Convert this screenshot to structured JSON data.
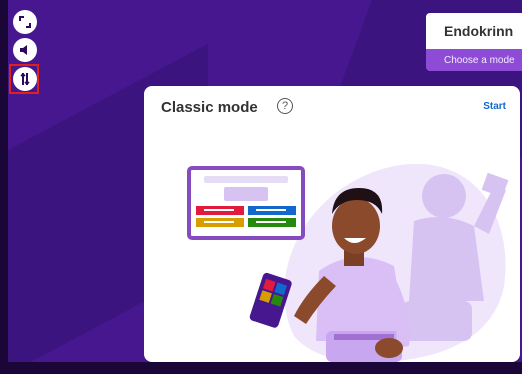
{
  "quiz": {
    "title": "Endokrinn",
    "subtitle": "Choose a mode"
  },
  "mode_card": {
    "title": "Classic mode",
    "help_glyph": "?",
    "start_label": "Start"
  },
  "sidebar": {
    "buttons": [
      {
        "icon": "fullscreen-icon"
      },
      {
        "icon": "sound-icon"
      },
      {
        "icon": "settings-sliders-icon",
        "highlighted": true
      }
    ]
  },
  "colors": {
    "background": "#46178f",
    "accent_purple": "#8e4cd6",
    "start_blue": "#1368ce",
    "highlight_red": "#e0211b",
    "answer_red": "#e21b3c",
    "answer_blue": "#1368ce",
    "answer_yellow": "#d89e00",
    "answer_green": "#26890c"
  }
}
